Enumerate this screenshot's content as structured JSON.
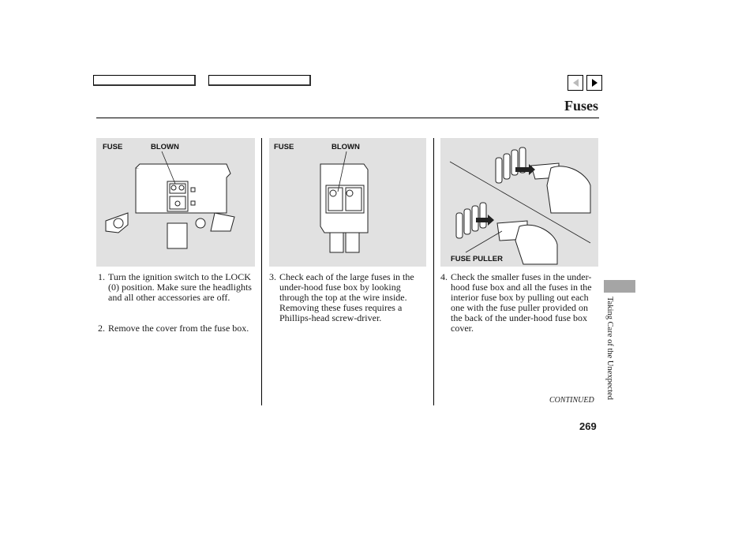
{
  "header": {
    "nav_boxes": [
      "",
      ""
    ],
    "prev_icon": "triangle-left",
    "next_icon": "triangle-right",
    "title": "Fuses"
  },
  "figures": [
    {
      "labels": [
        "FUSE",
        "BLOWN"
      ]
    },
    {
      "labels": [
        "FUSE",
        "BLOWN"
      ]
    },
    {
      "labels": [
        "FUSE PULLER"
      ]
    }
  ],
  "steps": [
    {
      "num": "1.",
      "text": "Turn the ignition switch to the LOCK (0) position. Make sure the headlights and all other accessories are off."
    },
    {
      "num": "2.",
      "text": "Remove the cover from the fuse box."
    },
    {
      "num": "3.",
      "text": "Check each of the large fuses in the under-hood fuse box by looking through the top at the wire inside. Removing these fuses requires a Phillips-head screw-driver."
    },
    {
      "num": "4.",
      "text": "Check the smaller fuses in the under-hood fuse box and all the fuses in the interior fuse box by pulling out each one with the fuse puller provided on the back of the under-hood fuse box cover."
    }
  ],
  "footer": {
    "continued": "CONTINUED",
    "page_number": "269"
  },
  "side_tab": {
    "section": "Taking Care of the Unexpected",
    "color": "#a5a5a5"
  }
}
